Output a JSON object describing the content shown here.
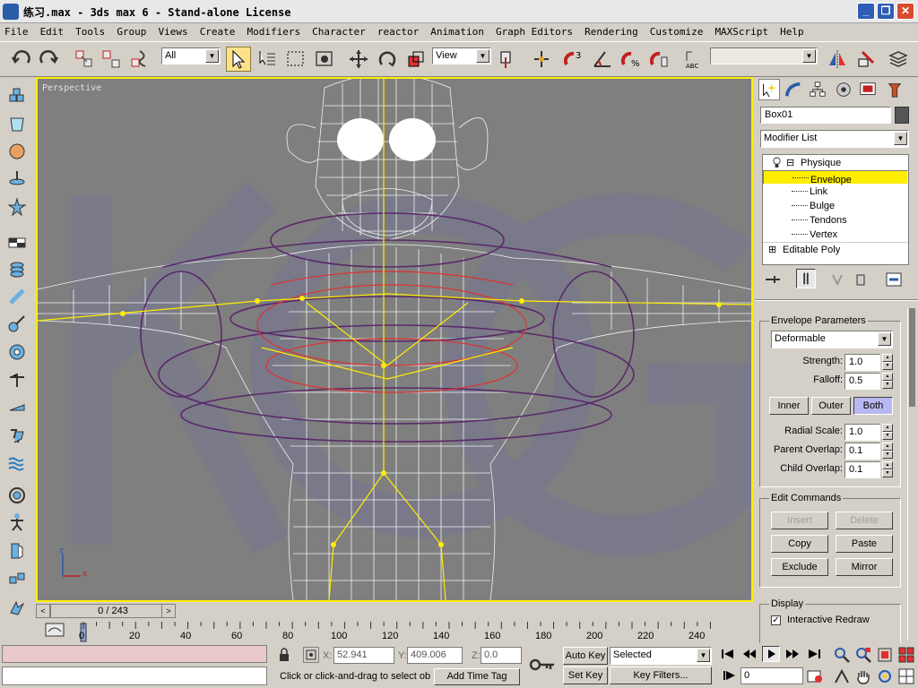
{
  "window": {
    "title": "练习.max - 3ds max 6 - Stand-alone License",
    "controls": [
      "_",
      "❐",
      "✕"
    ]
  },
  "menu": [
    "File",
    "Edit",
    "Tools",
    "Group",
    "Views",
    "Create",
    "Modifiers",
    "Character",
    "reactor",
    "Animation",
    "Graph Editors",
    "Rendering",
    "Customize",
    "MAXScript",
    "Help"
  ],
  "toolbar": {
    "selection_filter": "All",
    "ref_coord": "View",
    "named_selection": ""
  },
  "viewport": {
    "label": "Perspective",
    "axis_z": "z",
    "axis_x": "x"
  },
  "timeline": {
    "frame_display": "0 / 243",
    "prev": "<",
    "next": ">",
    "ticks": [
      "0",
      "20",
      "40",
      "60",
      "80",
      "100",
      "120",
      "140",
      "160",
      "180",
      "200",
      "220",
      "240"
    ]
  },
  "command_panel": {
    "object_name": "Box01",
    "modifier_list": "Modifier List",
    "stack": [
      {
        "label": "Physique",
        "sign": "⊟",
        "level": 0
      },
      {
        "label": "Envelope",
        "level": 1,
        "selected": true
      },
      {
        "label": "Link",
        "level": 1
      },
      {
        "label": "Bulge",
        "level": 1
      },
      {
        "label": "Tendons",
        "level": 1
      },
      {
        "label": "Vertex",
        "level": 1
      },
      {
        "label": "Editable Poly",
        "sign": "⊞",
        "level": 0
      }
    ],
    "envelope_params": {
      "title": "Envelope Parameters",
      "type": "Deformable",
      "strength_label": "Strength:",
      "strength": "1.0",
      "falloff_label": "Falloff:",
      "falloff": "0.5",
      "inner": "Inner",
      "outer": "Outer",
      "both": "Both",
      "radial_scale_label": "Radial Scale:",
      "radial_scale": "1.0",
      "parent_overlap_label": "Parent Overlap:",
      "parent_overlap": "0.1",
      "child_overlap_label": "Child Overlap:",
      "child_overlap": "0.1"
    },
    "edit_commands": {
      "title": "Edit Commands",
      "insert": "Insert",
      "delete": "Delete",
      "copy": "Copy",
      "paste": "Paste",
      "exclude": "Exclude",
      "mirror": "Mirror"
    },
    "display": {
      "title": "Display",
      "interactive_redraw": "Interactive Redraw",
      "interactive_redraw_checked": true
    }
  },
  "status": {
    "x_label": "X:",
    "x": "52.941",
    "y_label": "Y:",
    "y": "409.006",
    "z_label": "Z:",
    "z": "0.0",
    "prompt": "Click or click-and-drag to select obj",
    "add_time_tag": "Add Time Tag",
    "auto_key": "Auto Key",
    "set_key": "Set Key",
    "key_mode": "Selected",
    "key_filters": "Key Filters...",
    "current_frame": "0"
  },
  "colors": {
    "viewport_bg": "#7f7f7f",
    "active_border": "#ffee00",
    "selection_highlight": "#ffee00",
    "envelope_outer": "#5a2a6a",
    "envelope_inner": "#e03030",
    "bones": "#ffee00"
  }
}
